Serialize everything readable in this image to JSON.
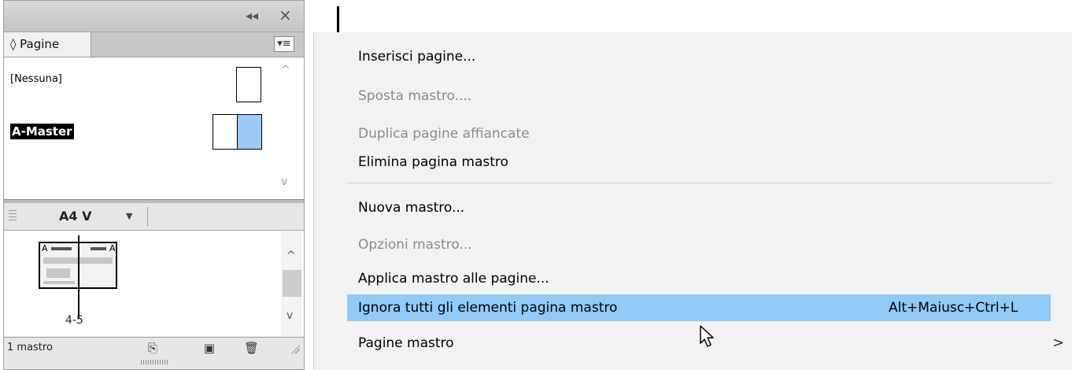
{
  "panel": {
    "tab_label": "◊ Pagine",
    "collapse_glyph": "◂◂",
    "close_glyph": "×",
    "menu_glyph": "▾≡",
    "masters": [
      {
        "label": "[Nessuna]"
      },
      {
        "label": "A-Master",
        "selected": true
      }
    ],
    "page_size": "A4 V",
    "spread_label": "4-5",
    "spread_mark_left": "A",
    "spread_mark_right": "A",
    "status_text": "1 mastro"
  },
  "menu": {
    "items": [
      {
        "label": "Inserisci pagine...",
        "enabled": true
      },
      {
        "label": "Sposta mastro....",
        "enabled": false
      },
      {
        "label": "Duplica pagine affiancate",
        "enabled": false
      },
      {
        "label": "Elimina pagina mastro",
        "enabled": true
      },
      {
        "label": "Nuova mastro...",
        "enabled": true
      },
      {
        "label": "Opzioni mastro...",
        "enabled": false
      },
      {
        "label": "Applica mastro alle pagine...",
        "enabled": true
      },
      {
        "label": "Ignora tutti gli elementi pagina mastro",
        "enabled": true,
        "shortcut": "Alt+Maiusc+Ctrl+L",
        "highlighted": true
      },
      {
        "label": "Pagine mastro",
        "enabled": true,
        "submenu_arrow": ">"
      }
    ]
  },
  "colors": {
    "menu_highlight": "#91c9f7",
    "master_thumb_blue": "#9bcbf5",
    "disabled_text": "#8b8b8b"
  }
}
